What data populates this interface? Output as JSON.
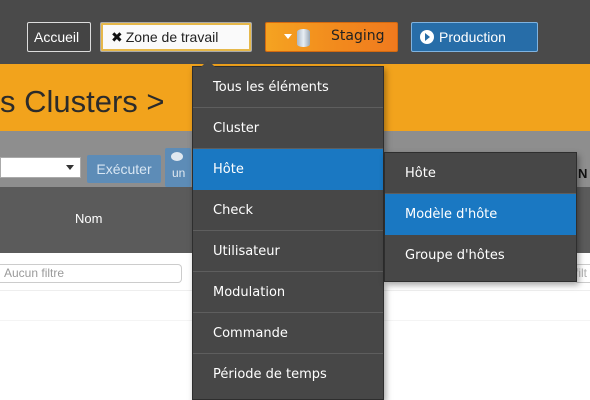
{
  "topbar": {
    "accueil_label": "Accueil",
    "zone_label": "Zone de travail",
    "staging_label": "Staging",
    "production_label": "Production"
  },
  "page": {
    "title": "s Clusters >"
  },
  "toolbar": {
    "execute_label": "Exécuter",
    "comment_label": "un",
    "right_fragment": "N"
  },
  "table": {
    "column_nom": "Nom",
    "filter_placeholder": "Aucun filtre",
    "filter_right_fragment": "filt"
  },
  "menu": {
    "items": [
      {
        "label": "Tous les éléments"
      },
      {
        "label": "Cluster"
      },
      {
        "label": "Hôte",
        "active": true,
        "has_submenu": true
      },
      {
        "label": "Check"
      },
      {
        "label": "Utilisateur"
      },
      {
        "label": "Modulation"
      },
      {
        "label": "Commande"
      },
      {
        "label": "Période de temps"
      }
    ]
  },
  "submenu": {
    "items": [
      {
        "label": "Hôte"
      },
      {
        "label": "Modèle d'hôte",
        "active": true
      },
      {
        "label": "Groupe d'hôtes"
      }
    ]
  },
  "colors": {
    "accent_blue": "#1a78c2",
    "staging_orange": "#f28a1d",
    "title_band": "#f2a31c",
    "production_blue": "#276da8"
  }
}
